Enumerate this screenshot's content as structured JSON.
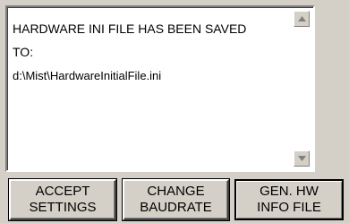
{
  "message": {
    "line1": "HARDWARE INI FILE HAS BEEN SAVED",
    "line2": "TO:",
    "line3": "d:\\Mist\\HardwareInitialFile.ini"
  },
  "buttons": {
    "accept": {
      "line1": "ACCEPT",
      "line2": "SETTINGS"
    },
    "change": {
      "line1": "CHANGE",
      "line2": "BAUDRATE"
    },
    "genhw": {
      "line1": "GEN. HW",
      "line2": "INFO FILE"
    }
  },
  "icons": {
    "scroll_up": "triangle-up-icon",
    "scroll_down": "triangle-down-icon"
  }
}
